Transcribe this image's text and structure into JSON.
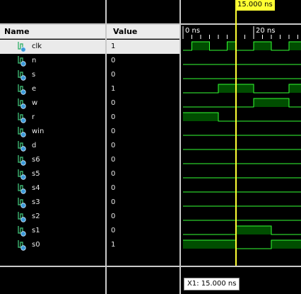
{
  "headers": {
    "name": "Name",
    "value": "Value"
  },
  "signals": [
    {
      "name": "clk",
      "value": "1",
      "selected": true,
      "wave": [
        [
          0,
          1,
          0
        ],
        [
          1,
          3,
          1
        ],
        [
          3,
          5,
          0
        ],
        [
          5,
          6,
          1
        ],
        [
          6,
          7,
          0
        ],
        [
          7,
          8,
          0
        ],
        [
          8,
          10,
          1
        ],
        [
          10,
          11,
          0
        ],
        [
          11,
          12,
          0
        ],
        [
          12,
          14,
          1
        ]
      ]
    },
    {
      "name": "n",
      "value": "0",
      "wave": [
        [
          0,
          14,
          0
        ]
      ]
    },
    {
      "name": "s",
      "value": "0",
      "wave": [
        [
          0,
          14,
          0
        ]
      ]
    },
    {
      "name": "e",
      "value": "1",
      "wave": [
        [
          0,
          4,
          0
        ],
        [
          4,
          8,
          1
        ],
        [
          8,
          12,
          0
        ],
        [
          12,
          14,
          1
        ]
      ]
    },
    {
      "name": "w",
      "value": "0",
      "wave": [
        [
          0,
          8,
          0
        ],
        [
          8,
          12,
          1
        ],
        [
          12,
          14,
          0
        ]
      ]
    },
    {
      "name": "r",
      "value": "0",
      "wave": [
        [
          0,
          4,
          1
        ],
        [
          4,
          14,
          0
        ]
      ]
    },
    {
      "name": "win",
      "value": "0",
      "wave": [
        [
          0,
          14,
          0
        ]
      ]
    },
    {
      "name": "d",
      "value": "0",
      "wave": [
        [
          0,
          14,
          0
        ]
      ]
    },
    {
      "name": "s6",
      "value": "0",
      "wave": [
        [
          0,
          14,
          0
        ]
      ]
    },
    {
      "name": "s5",
      "value": "0",
      "wave": [
        [
          0,
          14,
          0
        ]
      ]
    },
    {
      "name": "s4",
      "value": "0",
      "wave": [
        [
          0,
          14,
          0
        ]
      ]
    },
    {
      "name": "s3",
      "value": "0",
      "wave": [
        [
          0,
          14,
          0
        ]
      ]
    },
    {
      "name": "s2",
      "value": "0",
      "wave": [
        [
          0,
          14,
          0
        ]
      ]
    },
    {
      "name": "s1",
      "value": "0",
      "wave": [
        [
          0,
          6,
          0
        ],
        [
          6,
          10,
          1
        ],
        [
          10,
          14,
          0
        ]
      ]
    },
    {
      "name": "s0",
      "value": "1",
      "wave": [
        [
          0,
          6,
          1
        ],
        [
          6,
          10,
          0
        ],
        [
          10,
          14,
          1
        ]
      ]
    }
  ],
  "timeline": {
    "ticks": [
      {
        "label": "0 ns",
        "t": 0
      },
      {
        "label": "20 ns",
        "t": 8
      }
    ],
    "cursor_label": "15.000 ns",
    "cursor_t": 6
  },
  "footer": {
    "x1_label": "X1: 15.000 ns"
  },
  "colors": {
    "wave_line": "#33ff33",
    "wave_fill": "#004d00",
    "cursor": "#ffff33"
  }
}
